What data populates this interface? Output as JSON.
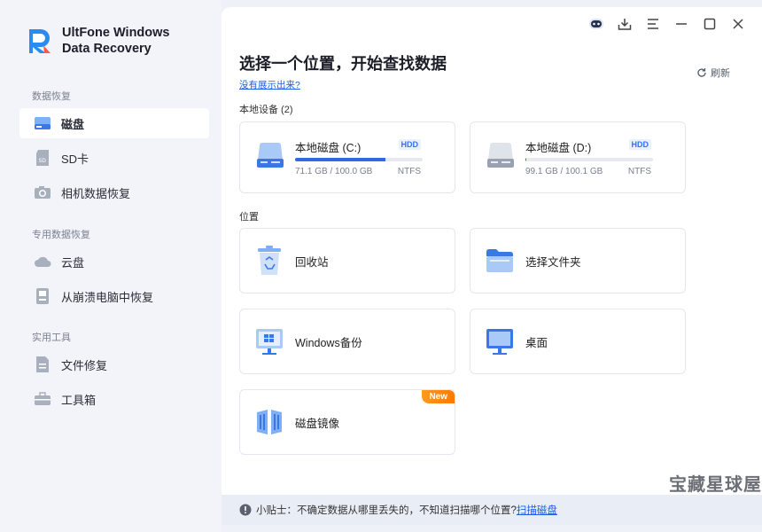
{
  "app": {
    "title_line1": "UltFone Windows",
    "title_line2": "Data Recovery"
  },
  "sidebar": {
    "sections": [
      {
        "title": "数据恢复",
        "items": [
          {
            "label": "磁盘",
            "active": true
          },
          {
            "label": "SD卡"
          },
          {
            "label": "相机数据恢复"
          }
        ]
      },
      {
        "title": "专用数据恢复",
        "items": [
          {
            "label": "云盘"
          },
          {
            "label": "从崩溃电脑中恢复"
          }
        ]
      },
      {
        "title": "实用工具",
        "items": [
          {
            "label": "文件修复"
          },
          {
            "label": "工具箱"
          }
        ]
      }
    ]
  },
  "main": {
    "title": "选择一个位置，开始查找数据",
    "not_shown_link": "没有展示出来?",
    "refresh_label": "刷新",
    "local_devices_label": "本地设备 (2)",
    "drives": [
      {
        "name": "本地磁盘 (C:)",
        "badge": "HDD",
        "size": "71.1 GB / 100.0 GB",
        "fs": "NTFS",
        "used_fraction": 0.711
      },
      {
        "name": "本地磁盘 (D:)",
        "badge": "HDD",
        "size": "99.1 GB / 100.1 GB",
        "fs": "NTFS",
        "used_fraction": 0.01
      }
    ],
    "locations_label": "位置",
    "locations": [
      {
        "label": "回收站",
        "icon": "recycle-bin-icon"
      },
      {
        "label": "选择文件夹",
        "icon": "folder-icon"
      },
      {
        "label": "Windows备份",
        "icon": "windows-backup-icon"
      },
      {
        "label": "桌面",
        "icon": "desktop-icon"
      },
      {
        "label": "磁盘镜像",
        "icon": "disk-image-icon",
        "badge": "New"
      }
    ]
  },
  "tipbar": {
    "prefix": "小贴士：不确定数据从哪里丢失的，不知道扫描哪个位置?",
    "link": "扫描磁盘"
  },
  "watermark": "宝藏星球屋",
  "colors": {
    "accent": "#2f6ae6",
    "new_badge": "#ff8a00",
    "sidebar_bg": "#f2f4f9"
  }
}
